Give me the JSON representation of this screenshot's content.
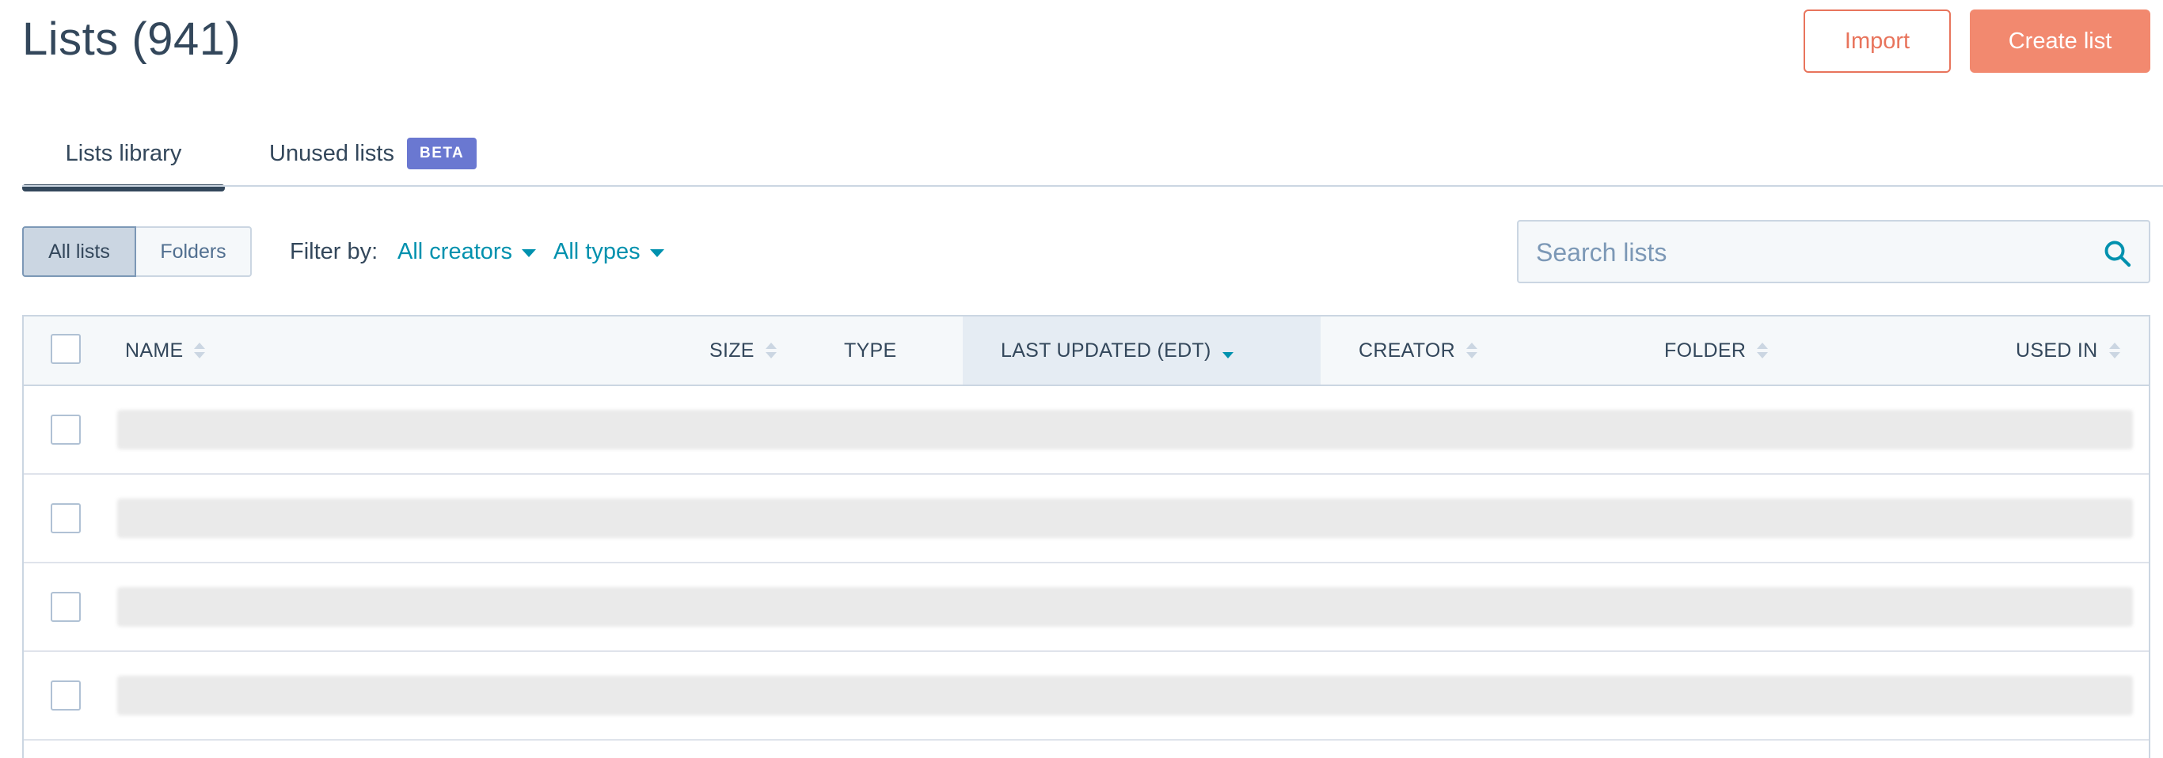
{
  "header": {
    "title": "Lists (941)",
    "import_label": "Import",
    "create_label": "Create list"
  },
  "tabs": [
    {
      "label": "Lists library",
      "active": true
    },
    {
      "label": "Unused lists",
      "badge": "BETA",
      "active": false
    }
  ],
  "view_toggle": {
    "all": "All lists",
    "folders": "Folders",
    "selected": "All lists"
  },
  "filters": {
    "label": "Filter by:",
    "creators": "All creators",
    "types": "All types"
  },
  "search": {
    "placeholder": "Search lists",
    "value": ""
  },
  "table": {
    "columns": [
      {
        "label": "NAME",
        "sortable": true
      },
      {
        "label": "SIZE",
        "sortable": true
      },
      {
        "label": "TYPE",
        "sortable": false
      },
      {
        "label": "LAST UPDATED (EDT)",
        "sortable": true,
        "sort": "desc"
      },
      {
        "label": "CREATOR",
        "sortable": true
      },
      {
        "label": "FOLDER",
        "sortable": true
      },
      {
        "label": "USED IN",
        "sortable": true
      }
    ],
    "loading_rows": 4
  },
  "colors": {
    "accent": "#f2896f",
    "accent_border": "#e8745c",
    "link": "#0091ae",
    "text": "#33475b",
    "beta_badge": "#6a78d1"
  }
}
